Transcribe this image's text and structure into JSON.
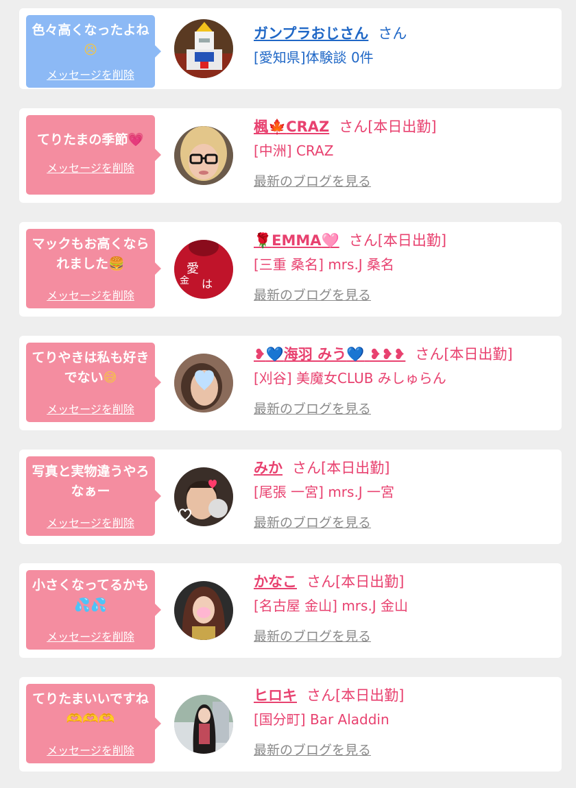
{
  "delete_label": "メッセージを削除",
  "blog_label": "最新のブログを見る",
  "items": [
    {
      "bubble_color": "#8cb9f5",
      "message": "色々高くなったよね",
      "message_emoji": "😣",
      "name": "ガンプラおじさん",
      "suffix": "さん",
      "detail": "[愛知県]体験談 0件",
      "text_color": "#1f67c6",
      "avatar_icon": "gundam-avatar"
    },
    {
      "bubble_color": "#f48da0",
      "message": "てりたまの季節",
      "message_emoji": "💗",
      "name_parts": [
        "楓",
        "🍁",
        "CRAZ"
      ],
      "suffix": "さん[本日出勤]",
      "detail": "[中洲] CRAZ",
      "text_color": "#e8416f",
      "avatar_icon": "glasses-woman-avatar"
    },
    {
      "bubble_color": "#f48da0",
      "message": "マックもお高くなられました",
      "message_emoji": "🍔",
      "name_parts": [
        "🌹",
        "EMMA",
        "🩷"
      ],
      "suffix": "さん[本日出勤]",
      "detail": "[三重 桑名] mrs.J 桑名",
      "text_color": "#e8416f",
      "avatar_icon": "red-sweater-avatar"
    },
    {
      "bubble_color": "#f48da0",
      "message": "てりやきは私も好きでない",
      "message_emoji": "😅",
      "name_parts": [
        "❥",
        "💙",
        "海羽 みう",
        "💙",
        "❥❥❥"
      ],
      "suffix": "さん[本日出勤]",
      "detail": "[刈谷] 美魔女CLUB みしゅらん",
      "text_color": "#e8416f",
      "avatar_icon": "blurred-face-avatar"
    },
    {
      "bubble_color": "#f48da0",
      "message": "写真と実物違うやろなぁー",
      "message_emoji": "",
      "name": "みか",
      "suffix": "さん[本日出勤]",
      "detail": "[尾張 一宮] mrs.J 一宮",
      "text_color": "#e8416f",
      "avatar_icon": "selfie-stickers-avatar"
    },
    {
      "bubble_color": "#f48da0",
      "message": "小さくなってるかも",
      "message_emoji": "💦💦",
      "name": "かなこ",
      "suffix": "さん[本日出勤]",
      "detail": "[名古屋 金山] mrs.J 金山",
      "text_color": "#e8416f",
      "avatar_icon": "long-hair-woman-avatar"
    },
    {
      "bubble_color": "#f48da0",
      "message": "てりたまいいですね",
      "message_emoji": "🫶🫶🫶",
      "name": "ヒロキ",
      "suffix": "さん[本日出勤]",
      "detail": "[国分町] Bar Aladdin",
      "text_color": "#e8416f",
      "avatar_icon": "standing-woman-avatar"
    }
  ]
}
